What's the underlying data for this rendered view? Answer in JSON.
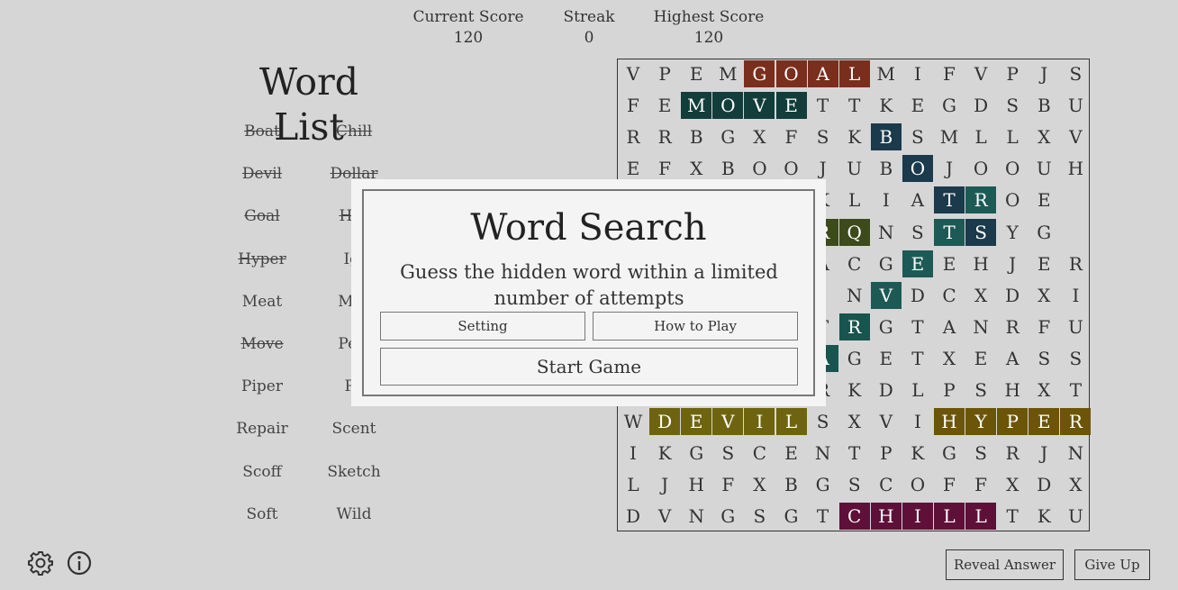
{
  "scores": {
    "current": {
      "label": "Current Score",
      "value": "120"
    },
    "streak": {
      "label": "Streak",
      "value": "0"
    },
    "highest": {
      "label": "Highest Score",
      "value": "120"
    }
  },
  "word_list": {
    "title": "Word List",
    "words": [
      {
        "text": "Boat",
        "found": true
      },
      {
        "text": "Chill",
        "found": true
      },
      {
        "text": "Devil",
        "found": true
      },
      {
        "text": "Dollar",
        "found": true
      },
      {
        "text": "Goal",
        "found": true
      },
      {
        "text": "Har",
        "found": true
      },
      {
        "text": "Hyper",
        "found": true
      },
      {
        "text": "Igl",
        "found": false
      },
      {
        "text": "Meat",
        "found": false
      },
      {
        "text": "Mer",
        "found": false
      },
      {
        "text": "Move",
        "found": true
      },
      {
        "text": "Perf",
        "found": false
      },
      {
        "text": "Piper",
        "found": false
      },
      {
        "text": "Po",
        "found": false
      },
      {
        "text": "Repair",
        "found": false
      },
      {
        "text": "Scent",
        "found": false
      },
      {
        "text": "Scoff",
        "found": false
      },
      {
        "text": "Sketch",
        "found": false
      },
      {
        "text": "Soft",
        "found": false
      },
      {
        "text": "Wild",
        "found": false
      }
    ]
  },
  "grid": {
    "rows": [
      "VPEMGOALMIFVPJS",
      "FEMOVETTKEGDSBU",
      "RRBGXFSKBSMLLXV",
      "EFXBOOJUBOJOOUH",
      "     SKLIATROE ",
      "     ARQNSTSYG ",
      "      ACGEEHJER",
      "      INVDCXDXI",
      "      TRGTANRFU",
      "      AGETXEASS",
      "      RKDLPSHXT",
      "WDEVILSXVIHYPER",
      "IKGSCENTPKGSRJN",
      "LJHFXBGSCOFFXDX",
      "DVNGSGTCHILLTKU"
    ],
    "highlights": [
      {
        "color": "#7a2e1d",
        "cells": [
          [
            0,
            4
          ],
          [
            0,
            5
          ],
          [
            0,
            6
          ],
          [
            0,
            7
          ]
        ]
      },
      {
        "color": "#123d3a",
        "cells": [
          [
            1,
            2
          ],
          [
            1,
            3
          ],
          [
            1,
            4
          ],
          [
            1,
            5
          ]
        ]
      },
      {
        "color": "#1b3a4b",
        "cells": [
          [
            2,
            8
          ],
          [
            3,
            9
          ],
          [
            4,
            10
          ],
          [
            5,
            11
          ]
        ]
      },
      {
        "color": "#1d5a55",
        "cells": [
          [
            4,
            11
          ],
          [
            5,
            10
          ],
          [
            6,
            9
          ],
          [
            7,
            8
          ]
        ]
      },
      {
        "color": "#19544f",
        "cells": [
          [
            8,
            7
          ],
          [
            9,
            6
          ]
        ]
      },
      {
        "color": "#3d4a1c",
        "cells": [
          [
            5,
            6
          ],
          [
            5,
            7
          ]
        ]
      },
      {
        "color": "#6e6410",
        "cells": [
          [
            11,
            1
          ],
          [
            11,
            2
          ],
          [
            11,
            3
          ],
          [
            11,
            4
          ],
          [
            11,
            5
          ]
        ]
      },
      {
        "color": "#6c5408",
        "cells": [
          [
            11,
            10
          ],
          [
            11,
            11
          ],
          [
            11,
            12
          ],
          [
            11,
            13
          ],
          [
            11,
            14
          ]
        ]
      },
      {
        "color": "#5e1039",
        "cells": [
          [
            14,
            7
          ],
          [
            14,
            8
          ],
          [
            14,
            9
          ],
          [
            14,
            10
          ],
          [
            14,
            11
          ]
        ]
      }
    ]
  },
  "controls": {
    "reveal": "Reveal Answer",
    "giveup": "Give Up",
    "settings_icon": "gear-icon",
    "info_icon": "info-icon"
  },
  "modal": {
    "title": "Word Search",
    "subtitle": "Guess the hidden word within a limited number of attempts",
    "setting": "Setting",
    "howto": "How to Play",
    "start": "Start Game"
  }
}
